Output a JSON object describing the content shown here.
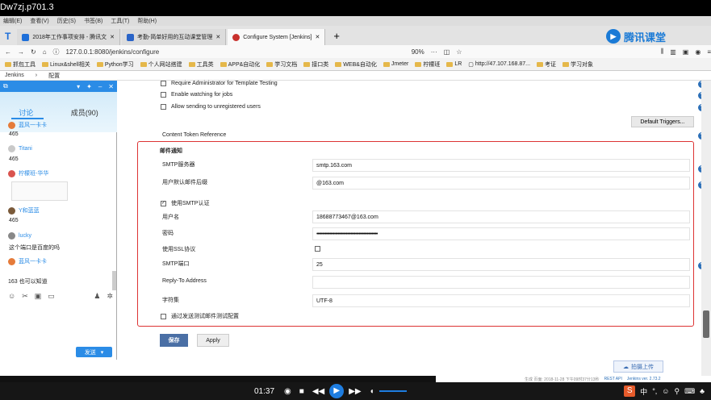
{
  "window_title": "Dw7zj.p701.3",
  "menu": [
    "编辑(E)",
    "查看(V)",
    "历史(S)",
    "书签(B)",
    "工具(T)",
    "帮助(H)"
  ],
  "tabs": [
    {
      "label": "2018年工作事项安排 - 腾讯文",
      "color": "#1e6fd9"
    },
    {
      "label": "考勤-简单好用的互动课堂管理",
      "color": "#2a64c8"
    },
    {
      "label": "Configure System [Jenkins]",
      "color": "#c8302c",
      "active": true
    }
  ],
  "brand": "腾讯课堂",
  "address": {
    "url": "127.0.0.1:8080/jenkins/configure",
    "zoom": "90%"
  },
  "bookmarks": [
    "抓包工具",
    "Linux&shell相关",
    "Python学习",
    "个人网站搭建",
    "工具类",
    "APP&自动化",
    "学习文档",
    "接口类",
    "WEB&自动化",
    "Jmeter",
    "柠檬班",
    "LR",
    "http://47.107.168.87...",
    "考证",
    "学习对象"
  ],
  "breadcrumb": [
    "Jenkins",
    "配置"
  ],
  "jenkins": {
    "opt_template": "Require Administrator for Template Testing",
    "opt_watch": "Enable watching for jobs",
    "opt_unregistered": "Allow sending to unregistered users",
    "default_triggers": "Default Triggers...",
    "content_token": "Content Token Reference",
    "section_title": "邮件通知",
    "smtp_server_label": "SMTP服务器",
    "smtp_server_value": "smtp.163.com",
    "suffix_label": "用户默认邮件后缀",
    "suffix_value": "@163.com",
    "use_smtp_auth": "使用SMTP认证",
    "username_label": "用户名",
    "username_value": "18688773467@163.com",
    "password_label": "密码",
    "password_value": "••••••••••••••••••••••••••••••••••••••••••••••••••••",
    "ssl_label": "使用SSL协议",
    "port_label": "SMTP端口",
    "port_value": "25",
    "reply_label": "Reply-To Address",
    "reply_value": "",
    "charset_label": "字符集",
    "charset_value": "UTF-8",
    "test_label": "通过发送测试邮件测试配置",
    "save": "保存",
    "apply": "Apply",
    "upload": "拍摄上传"
  },
  "footer": {
    "generated": "生成 页面: 2018-11-28 下午09时37分13秒",
    "rest": "REST API",
    "version": "Jenkins ver. 2.73.2"
  },
  "qq": {
    "tab_discuss": "讨论",
    "tab_members": "成员(90)",
    "messages": [
      {
        "name": "蓝风一卡卡",
        "text": "465"
      },
      {
        "name": "Titani",
        "text": "465"
      },
      {
        "name": "柠檬班-华华",
        "text": ""
      },
      {
        "name": "Y和蓝蓝",
        "text": "465"
      },
      {
        "name": "lucky",
        "text": "这个端口是百度的吗"
      },
      {
        "name": "蓝风一卡卡",
        "text": ""
      }
    ],
    "input_text": "163 也可以知道",
    "send": "发送"
  },
  "player": {
    "time": "01:37"
  }
}
